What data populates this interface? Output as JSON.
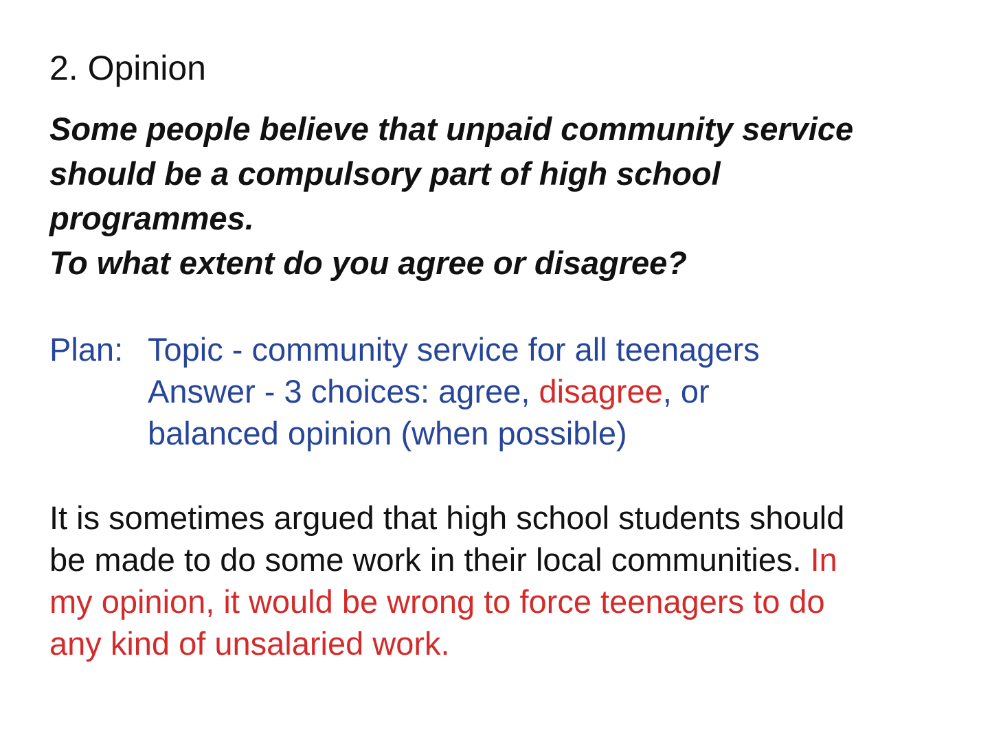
{
  "heading": "2. Opinion",
  "question": {
    "lines": [
      "Some people believe that unpaid community service",
      "should be a compulsory part of high school",
      "programmes.",
      "To what extent do you agree or disagree?"
    ]
  },
  "plan": {
    "label": "Plan:",
    "topic": "Topic - community service for all teenagers",
    "answer_prefix": "Answer - 3 choices: agree, ",
    "answer_highlight": "disagree",
    "answer_suffix": ", or",
    "answer_line2": "balanced opinion (when possible)"
  },
  "essay": {
    "line1": "It is sometimes argued that high school students should",
    "line2_black": "be made to do some work in their local communities.",
    "line2_red": "In",
    "line3": "my opinion, it would be wrong to force teenagers to do",
    "line4": "any kind of unsalaried work."
  },
  "colors": {
    "text": "#111111",
    "plan_blue": "#27469a",
    "highlight_red": "#d42a2a",
    "background": "#ffffff"
  }
}
